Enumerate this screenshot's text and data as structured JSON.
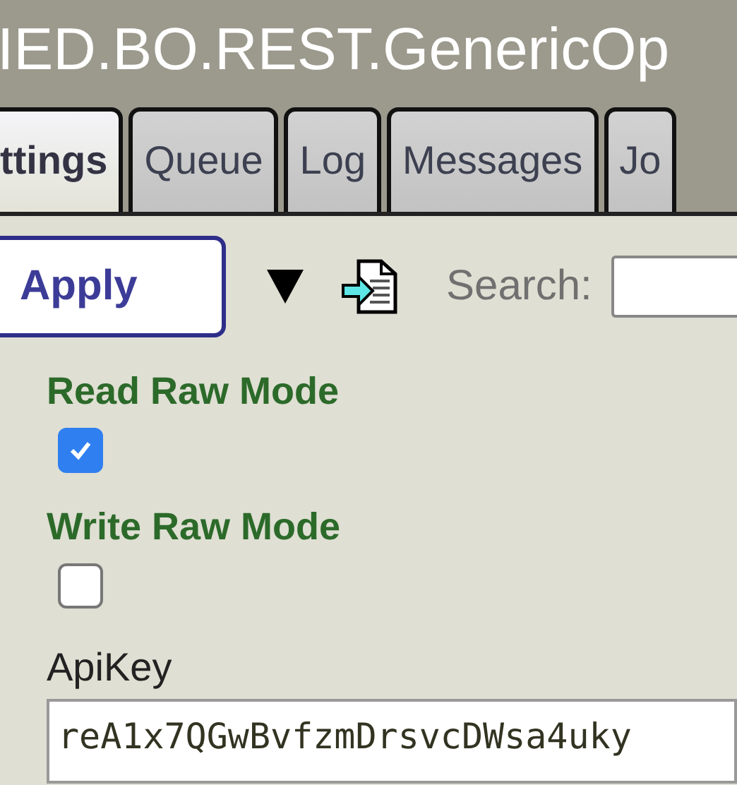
{
  "window": {
    "title": "IED.BO.REST.GenericOp"
  },
  "tabs": [
    {
      "label": "ttings",
      "selected": true
    },
    {
      "label": "Queue",
      "selected": false
    },
    {
      "label": "Log",
      "selected": false
    },
    {
      "label": "Messages",
      "selected": false
    },
    {
      "label": "Jo",
      "selected": false
    }
  ],
  "toolbar": {
    "apply_button": "Apply",
    "search": {
      "label": "Search:"
    }
  },
  "settings": [
    {
      "kind": "checkbox",
      "label": "Read Raw Mode",
      "checked": true
    },
    {
      "kind": "checkbox",
      "label": "Write Raw Mode",
      "checked": false
    },
    {
      "kind": "text",
      "label": "ApiKey",
      "value": "reA1x7QGwBvfzmDrsvcDWsa4uky"
    }
  ]
}
